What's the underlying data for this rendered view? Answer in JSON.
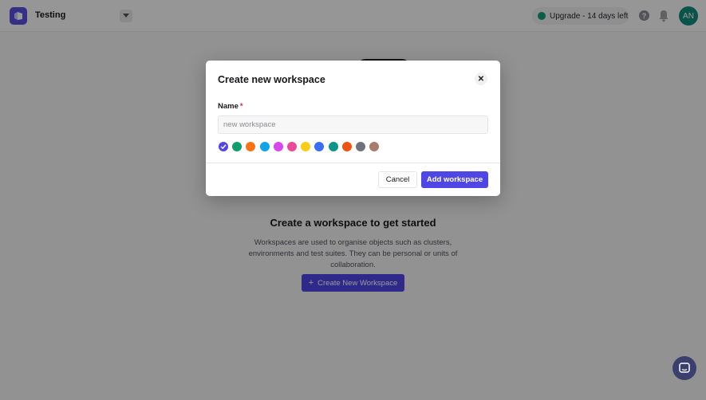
{
  "topbar": {
    "title": "Testing",
    "upgrade_label": "Upgrade - 14 days left",
    "help_glyph": "?",
    "avatar_initials": "AN",
    "icons": [
      "logo-icon",
      "chevron-down-icon",
      "status-dot-icon",
      "help-icon",
      "bell-icon"
    ]
  },
  "empty_state": {
    "title": "Create a workspace to get started",
    "description": "Workspaces are used to organise objects such as clusters, environments and test suites. They can be personal or units of collaboration.",
    "create_button_label": "Create New Workspace"
  },
  "modal": {
    "title": "Create new workspace",
    "name_label": "Name",
    "required_mark": "*",
    "name_placeholder": "new workspace",
    "name_value": "",
    "colors": [
      "#4f46e5",
      "#0f9d6e",
      "#f97316",
      "#0ea5e9",
      "#d946ef",
      "#ec4899",
      "#facc15",
      "#3b6ef5",
      "#0f9488",
      "#f0520f",
      "#71717a",
      "#a87b6b"
    ],
    "selected_color_index": 0,
    "cancel_label": "Cancel",
    "submit_label": "Add workspace"
  },
  "accent_color": "#4f46e5",
  "chat": {
    "icon": "chat-icon"
  }
}
